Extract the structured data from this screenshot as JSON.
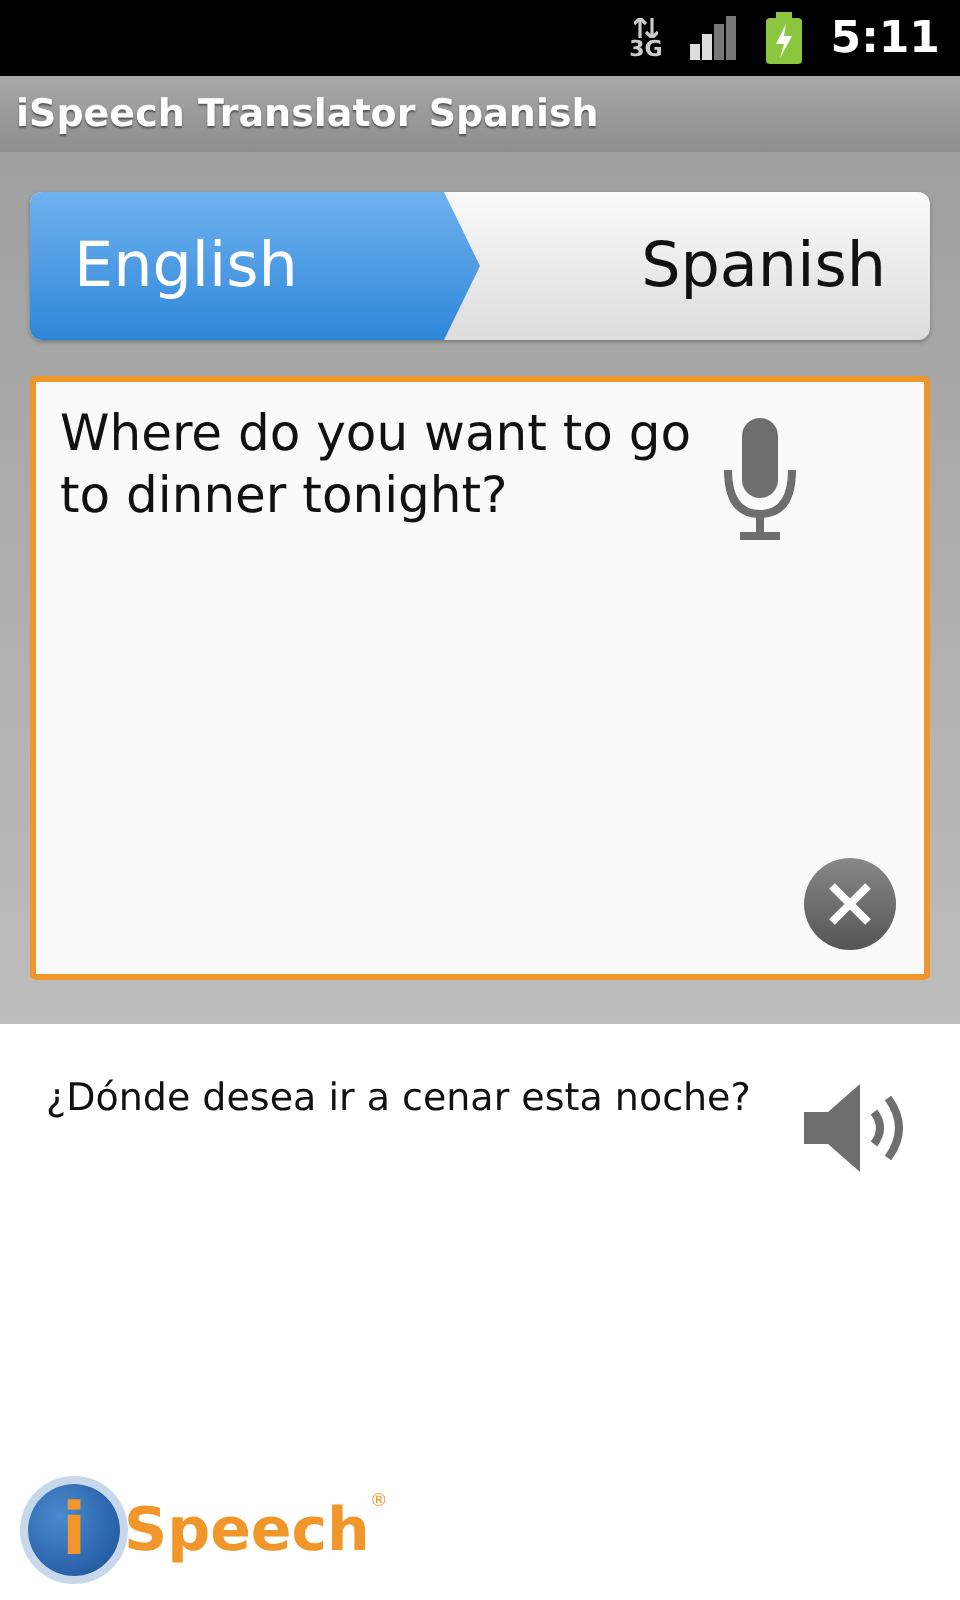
{
  "status_bar": {
    "network": "3G",
    "time": "5:11"
  },
  "title_bar": {
    "title": "iSpeech Translator Spanish"
  },
  "languages": [
    {
      "label": "English",
      "selected": true
    },
    {
      "label": "Spanish",
      "selected": false
    }
  ],
  "input": {
    "value": "Where do you want to go to dinner tonight?"
  },
  "translation": {
    "text": "¿Dónde desea ir a cenar esta noche?"
  },
  "logo": {
    "letter": "i",
    "name": "Speech",
    "mark": "®"
  }
}
